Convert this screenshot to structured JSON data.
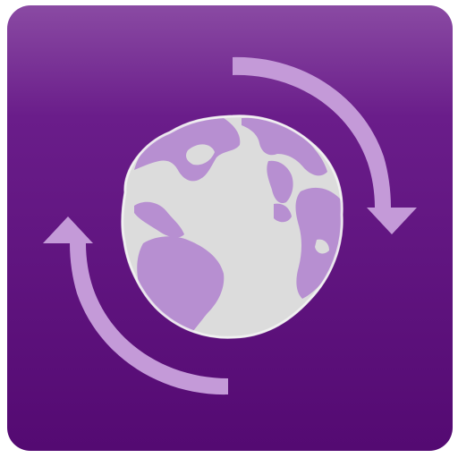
{
  "icon": {
    "name": "globe-sync-app-icon",
    "symbol": "globe-icon",
    "arrows": [
      "rotate-arrow-top-right-icon",
      "rotate-arrow-bottom-left-icon"
    ]
  },
  "colors": {
    "tile_top": "#8a4aa3",
    "tile_bottom": "#540a72",
    "globe_ocean": "#dcdcdc",
    "globe_land": "#b78fd1",
    "arrow": "#c49ad8"
  }
}
